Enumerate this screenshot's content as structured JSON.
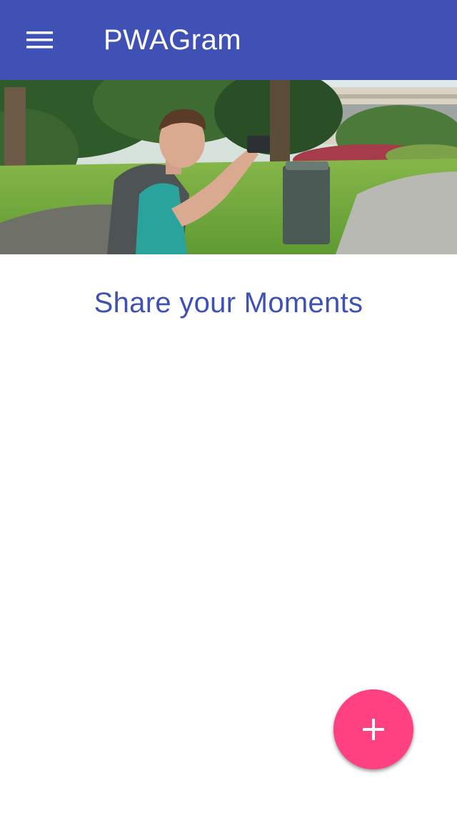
{
  "app_bar": {
    "menu_icon": "hamburger-menu-icon",
    "title": "PWAGram",
    "color": "#3f51b5"
  },
  "hero": {
    "description_icon": "hero-photo"
  },
  "main": {
    "headline": "Share your Moments",
    "headline_color": "#3f51b5"
  },
  "fab": {
    "icon": "add-icon",
    "color": "#ff4081"
  }
}
